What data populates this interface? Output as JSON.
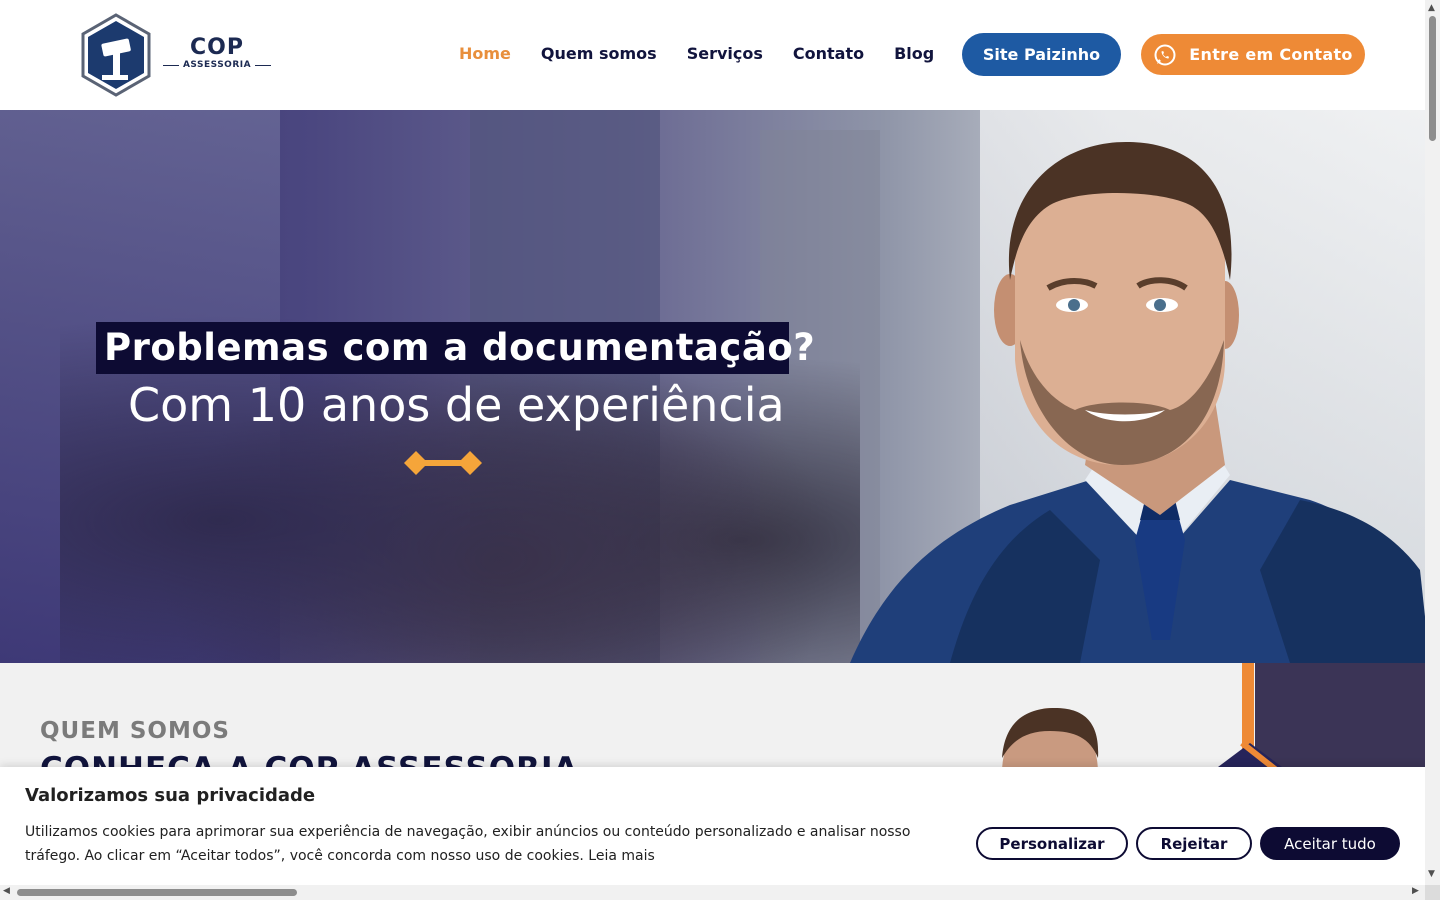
{
  "header": {
    "logo": {
      "brand": "COP",
      "sub": "ASSESSORIA"
    },
    "nav": [
      {
        "label": "Home",
        "active": true
      },
      {
        "label": "Quem somos",
        "active": false
      },
      {
        "label": "Serviços",
        "active": false
      },
      {
        "label": "Contato",
        "active": false
      },
      {
        "label": "Blog",
        "active": false
      }
    ],
    "site_button": "Site Paizinho",
    "contact_button": "Entre em Contato",
    "contact_icon": "whatsapp-icon"
  },
  "hero": {
    "headline": "Problemas com a documentação?",
    "subline": "Com 10 anos de experiência"
  },
  "about": {
    "kicker": "QUEM SOMOS",
    "title": "CONHEÇA A COP ASSESSORIA"
  },
  "cookie": {
    "title": "Valorizamos sua privacidade",
    "text": "Utilizamos cookies para aprimorar sua experiência de navegação, exibir anúncios ou conteúdo personalizado e analisar nosso tráfego. Ao clicar em “Aceitar todos”, você concorda com nosso uso de cookies.",
    "read_more": "Leia mais",
    "customize": "Personalizar",
    "reject": "Rejeitar",
    "accept": "Aceitar tudo"
  },
  "colors": {
    "navy": "#11143d",
    "accent_orange": "#ee8a36",
    "nav_active": "#e88f3c",
    "site_button_blue": "#1e5aa3",
    "headline_bg": "#0d0b33"
  }
}
